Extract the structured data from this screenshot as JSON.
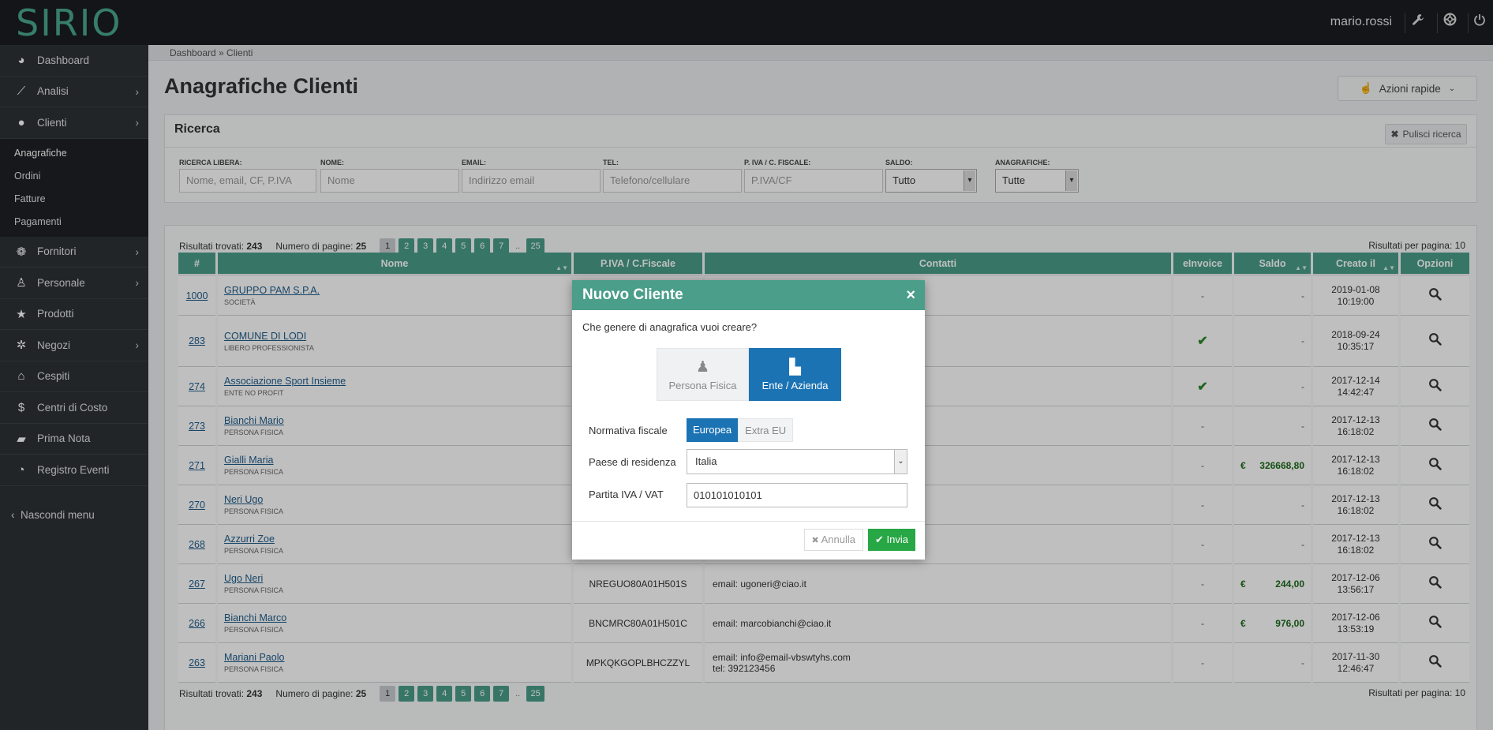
{
  "app": {
    "logo": "SIRIO",
    "username": "mario.rossi"
  },
  "icons": {
    "wrench": "wrench-icon",
    "help": "lifebuoy-icon",
    "power": "power-icon"
  },
  "sidebar": {
    "items": [
      {
        "label": "Dashboard",
        "icon": "dashboard-icon",
        "glyph": "◕"
      },
      {
        "label": "Analisi",
        "icon": "line-chart-icon",
        "glyph": "⟋"
      },
      {
        "label": "Clienti",
        "icon": "user-icon",
        "glyph": "●"
      }
    ],
    "sub_items": [
      "Anagrafiche",
      "Ordini",
      "Fatture",
      "Pagamenti"
    ],
    "items2": [
      {
        "label": "Fornitori",
        "icon": "users-icon",
        "glyph": "❁"
      },
      {
        "label": "Personale",
        "icon": "person-icon",
        "glyph": "♙"
      },
      {
        "label": "Prodotti",
        "icon": "star-icon",
        "glyph": "★"
      },
      {
        "label": "Negozi",
        "icon": "gear-icon",
        "glyph": "✲"
      },
      {
        "label": "Cespiti",
        "icon": "bank-icon",
        "glyph": "⌂"
      },
      {
        "label": "Centri di Costo",
        "icon": "dollar-icon",
        "glyph": "$"
      },
      {
        "label": "Prima Nota",
        "icon": "book-icon",
        "glyph": "▰"
      },
      {
        "label": "Registro Eventi",
        "icon": "rss-icon",
        "glyph": "◔"
      }
    ],
    "hide_menu": "Nascondi menu"
  },
  "breadcrumb": "Dashboard » Clienti",
  "page_title": "Anagrafiche Clienti",
  "quick_actions": "Azioni rapide",
  "search": {
    "title": "Ricerca",
    "clear": "Pulisci ricerca",
    "fields": [
      {
        "label": "RICERCA LIBERA:",
        "placeholder": "Nome, email, CF, P.IVA"
      },
      {
        "label": "NOME:",
        "placeholder": "Nome"
      },
      {
        "label": "EMAIL:",
        "placeholder": "Indirizzo email"
      },
      {
        "label": "TEL:",
        "placeholder": "Telefono/cellulare"
      },
      {
        "label": "P. IVA / C. FISCALE:",
        "placeholder": "P.IVA/CF"
      }
    ],
    "selects": [
      {
        "label": "SALDO:",
        "value": "Tutto"
      },
      {
        "label": "ANAGRAFICHE:",
        "value": "Tutte"
      }
    ]
  },
  "results": {
    "found_label": "Risultati trovati:",
    "found": "243",
    "pages_label": "Numero di pagine:",
    "pages": "25",
    "page_buttons": [
      "1",
      "2",
      "3",
      "4",
      "5",
      "6",
      "7",
      "..",
      "25"
    ],
    "per_page": "Risultati per pagina: 10"
  },
  "table": {
    "headers": [
      "#",
      "Nome",
      "P.IVA / C.Fiscale",
      "Contatti",
      "eInvoice",
      "Saldo",
      "Creato il",
      "Opzioni"
    ],
    "rows": [
      {
        "id": "1000",
        "name": "GRUPPO PAM S.P.A.",
        "type": "SOCIETÀ",
        "piva": "",
        "contacts": "",
        "contacts2": "",
        "einvoice": "-",
        "saldo": "-",
        "date": "2019-01-08",
        "time": "10:19:00"
      },
      {
        "id": "283",
        "name": "COMUNE DI LODI",
        "type": "LIBERO PROFESSIONISTA",
        "piva": "",
        "contacts": "",
        "contacts2": "",
        "einvoice": "check",
        "saldo": "-",
        "date": "2018-09-24",
        "time": "10:35:17"
      },
      {
        "id": "274",
        "name": "Associazione Sport Insieme",
        "type": "ENTE NO PROFIT",
        "piva": "",
        "contacts": "",
        "contacts2": "",
        "einvoice": "check",
        "saldo": "-",
        "date": "2017-12-14",
        "time": "14:42:47"
      },
      {
        "id": "273",
        "name": "Bianchi Mario",
        "type": "PERSONA FISICA",
        "piva": "",
        "contacts": "",
        "contacts2": "",
        "einvoice": "-",
        "saldo": "-",
        "date": "2017-12-13",
        "time": "16:18:02"
      },
      {
        "id": "271",
        "name": "Gialli Maria",
        "type": "PERSONA FISICA",
        "piva": "",
        "contacts": "",
        "contacts2": "",
        "einvoice": "-",
        "saldo": "326668,80",
        "date": "2017-12-13",
        "time": "16:18:02"
      },
      {
        "id": "270",
        "name": "Neri Ugo",
        "type": "PERSONA FISICA",
        "piva": "",
        "contacts": "",
        "contacts2": "",
        "einvoice": "-",
        "saldo": "-",
        "date": "2017-12-13",
        "time": "16:18:02"
      },
      {
        "id": "268",
        "name": "Azzurri Zoe",
        "type": "PERSONA FISICA",
        "piva": "",
        "contacts": "",
        "contacts2": "",
        "einvoice": "-",
        "saldo": "-",
        "date": "2017-12-13",
        "time": "16:18:02"
      },
      {
        "id": "267",
        "name": "Ugo Neri",
        "type": "PERSONA FISICA",
        "piva": "NREGUO80A01H501S",
        "contacts": "email: ugoneri@ciao.it",
        "contacts2": "",
        "einvoice": "-",
        "saldo": "244,00",
        "date": "2017-12-06",
        "time": "13:56:17"
      },
      {
        "id": "266",
        "name": "Bianchi Marco",
        "type": "PERSONA FISICA",
        "piva": "BNCMRC80A01H501C",
        "contacts": "email: marcobianchi@ciao.it",
        "contacts2": "",
        "einvoice": "-",
        "saldo": "976,00",
        "date": "2017-12-06",
        "time": "13:53:19"
      },
      {
        "id": "263",
        "name": "Mariani Paolo",
        "type": "PERSONA FISICA",
        "piva": "MPKQKGOPLBHCZZYL",
        "contacts": "email: info@email-vbswtyhs.com",
        "contacts2": "tel: 392123456",
        "einvoice": "-",
        "saldo": "-",
        "date": "2017-11-30",
        "time": "12:46:47"
      }
    ],
    "currency": "€"
  },
  "modal": {
    "title": "Nuovo Cliente",
    "close": "×",
    "question": "Che genere di anagrafica vuoi creare?",
    "type_options": [
      {
        "label": "Persona Fisica",
        "icon": "person-icon",
        "glyph": "♟",
        "selected": false
      },
      {
        "label": "Ente / Azienda",
        "icon": "industry-icon",
        "glyph": "▙",
        "selected": true
      }
    ],
    "normativa_label": "Normativa fiscale",
    "normativa_options": [
      {
        "label": "Europea",
        "selected": true
      },
      {
        "label": "Extra EU",
        "selected": false
      }
    ],
    "country_label": "Paese di residenza",
    "country_value": "Italia",
    "vat_label": "Partita IVA / VAT",
    "vat_value": "010101010101",
    "cancel": "Annulla",
    "send": "Invia"
  },
  "colors": {
    "accent": "#4a9e8a",
    "primary": "#1c73b4",
    "success": "#27a745",
    "sidebar": "#2e3236",
    "topbar": "#1a1d20"
  }
}
